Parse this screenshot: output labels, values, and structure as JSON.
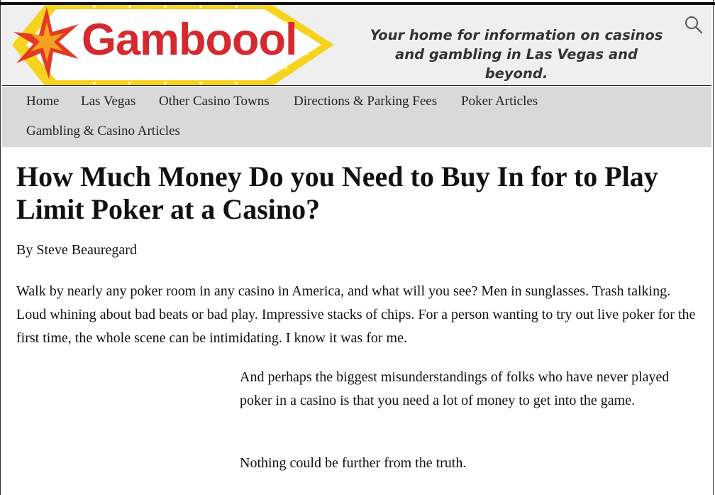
{
  "header": {
    "logo_text": "Gamboool",
    "tagline": "Your home for information on casinos and gambling in Las Vegas and beyond.",
    "colors": {
      "logo_red": "#d42a2f",
      "marquee_yellow": "#f6d31f",
      "header_bg": "#efefef",
      "nav_bg": "#d9d9d9"
    }
  },
  "nav": {
    "items": [
      {
        "label": "Home"
      },
      {
        "label": "Las Vegas"
      },
      {
        "label": "Other Casino Towns"
      },
      {
        "label": "Directions & Parking Fees"
      },
      {
        "label": "Poker Articles"
      },
      {
        "label": "Gambling & Casino Articles"
      }
    ]
  },
  "article": {
    "title": "How Much Money Do you Need to Buy In for to Play Limit Poker at a Casino?",
    "byline": "By Steve Beauregard",
    "paragraphs": [
      "Walk by nearly any poker room in any casino in America, and what will you see? Men in sunglasses. Trash talking. Loud whining about bad beats or bad play. Impressive stacks of chips. For a person wanting to try out live poker for the first time, the whole scene can be intimidating. I know it was for me.",
      "And perhaps the biggest misunderstandings of folks who have never played poker in a casino is that you need a lot of money to get into the game.",
      "Nothing could be further from the truth."
    ]
  },
  "icons": {
    "search": "search-icon",
    "logo_star": "star-burst-icon"
  }
}
